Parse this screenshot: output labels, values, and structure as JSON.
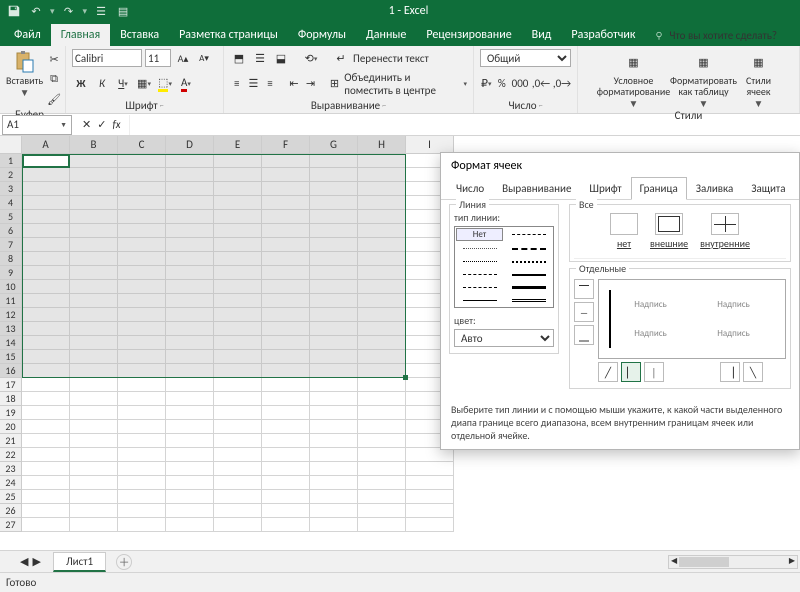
{
  "app": {
    "title": "1 - Excel"
  },
  "tabs": {
    "file": "Файл",
    "home": "Главная",
    "insert": "Вставка",
    "layout": "Разметка страницы",
    "formulas": "Формулы",
    "data": "Данные",
    "review": "Рецензирование",
    "view": "Вид",
    "developer": "Разработчик",
    "tellme": "Что вы хотите сделать?"
  },
  "ribbon": {
    "clipboard": {
      "paste": "Вставить",
      "label": "Буфер обмена"
    },
    "font": {
      "name": "Calibri",
      "size": "11",
      "label": "Шрифт"
    },
    "align": {
      "wrap": "Перенести текст",
      "merge": "Объединить и поместить в центре",
      "label": "Выравнивание"
    },
    "number": {
      "format": "Общий",
      "label": "Число"
    },
    "styles": {
      "cond": "Условное форматирование",
      "table": "Форматировать как таблицу",
      "cell": "Стили ячеек",
      "label": "Стили"
    }
  },
  "namebox": "A1",
  "sheets": {
    "tab1": "Лист1"
  },
  "status": {
    "ready": "Готово"
  },
  "dialog": {
    "title": "Формат ячеек",
    "tabs": {
      "number": "Число",
      "align": "Выравнивание",
      "font": "Шрифт",
      "border": "Граница",
      "fill": "Заливка",
      "protect": "Защита"
    },
    "line": {
      "group": "Линия",
      "type": "тип линии:",
      "none": "Нет",
      "color": "цвет:",
      "auto": "Авто"
    },
    "presets": {
      "group": "Все",
      "none": "нет",
      "outer": "внешние",
      "inner": "внутренние"
    },
    "individual": {
      "group": "Отдельные",
      "sample": "Надпись"
    },
    "hint": "Выберите тип линии и с помощью мыши укажите, к какой части выделенного диапа границе всего диапазона, всем внутренним границам ячеек или отдельной ячейке."
  },
  "cols": [
    "A",
    "B",
    "C",
    "D",
    "E",
    "F",
    "G",
    "H",
    "I"
  ]
}
